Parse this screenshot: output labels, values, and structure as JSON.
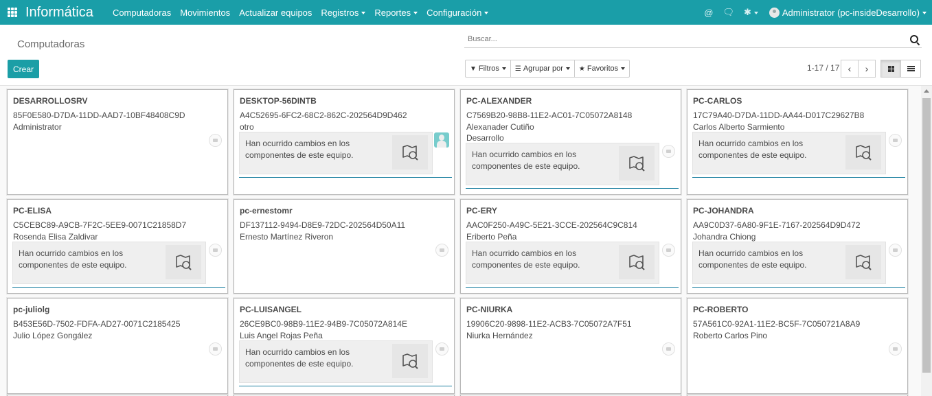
{
  "navbar": {
    "brand": "Informática",
    "menu": [
      {
        "label": "Computadoras",
        "has_caret": false
      },
      {
        "label": "Movimientos",
        "has_caret": false
      },
      {
        "label": "Actualizar equipos",
        "has_caret": false
      },
      {
        "label": "Registros",
        "has_caret": true
      },
      {
        "label": "Reportes",
        "has_caret": true
      },
      {
        "label": "Configuración",
        "has_caret": true
      }
    ],
    "user": "Administrator (pc-insideDesarrollo)",
    "color": "#1a9ea8"
  },
  "control_panel": {
    "breadcrumb": "Computadoras",
    "create_label": "Crear",
    "search_placeholder": "Buscar...",
    "filters_label": "Filtros",
    "group_by_label": "Agrupar por",
    "favorites_label": "Favoritos",
    "pager": "1-17 / 17"
  },
  "notice_text": "Han ocurrido cambios en los componentes de este equipo.",
  "cards": [
    {
      "name": "DESARROLLOSRV",
      "uuid": "85F0E580-D7DA-11DD-AAD7-10BF48408C9D",
      "line3": "Administrator",
      "line4": "",
      "has_notice": false,
      "has_photo": false
    },
    {
      "name": "DESKTOP-56DINTB",
      "uuid": "A4C52695-6FC2-68C2-862C-202564D9D462",
      "line3": "otro",
      "line4": "",
      "has_notice": true,
      "has_photo": true
    },
    {
      "name": "PC-ALEXANDER",
      "uuid": "C7569B20-98B8-11E2-AC01-7C05072A8148",
      "line3": "Alexanader Cutiño",
      "line4": "Desarrollo",
      "has_notice": true,
      "has_photo": false
    },
    {
      "name": "PC-CARLOS",
      "uuid": "17C79A40-D7DA-11DD-AA44-D017C29627B8",
      "line3": "Carlos Alberto Sarmiento",
      "line4": "",
      "has_notice": true,
      "has_photo": false
    },
    {
      "name": "PC-ELISA",
      "uuid": "C5CEBC89-A9CB-7F2C-5EE9-0071C21858D7",
      "line3": "Rosenda Elisa Zaldivar",
      "line4": "",
      "has_notice": true,
      "has_photo": false
    },
    {
      "name": "pc-ernestomr",
      "uuid": "DF137112-9494-D8E9-72DC-202564D50A11",
      "line3": "Ernesto Martínez Riveron",
      "line4": "",
      "has_notice": false,
      "has_photo": false
    },
    {
      "name": "PC-ERY",
      "uuid": "AAC0F250-A49C-5E21-3CCE-202564C9C814",
      "line3": "Eriberto Peña",
      "line4": "",
      "has_notice": true,
      "has_photo": false
    },
    {
      "name": "PC-JOHANDRA",
      "uuid": "AA9C0D37-6A80-9F1E-7167-202564D9D472",
      "line3": "Johandra Chiong",
      "line4": "",
      "has_notice": true,
      "has_photo": false
    },
    {
      "name": "pc-juliolg",
      "uuid": "B453E56D-7502-FDFA-AD27-0071C2185425",
      "line3": "Julio López Gongález",
      "line4": "",
      "has_notice": false,
      "has_photo": false
    },
    {
      "name": "PC-LUISANGEL",
      "uuid": "26CE9BC0-98B9-11E2-94B9-7C05072A814E",
      "line3": "Luis Angel Rojas Peña",
      "line4": "",
      "has_notice": true,
      "has_photo": false
    },
    {
      "name": "PC-NIURKA",
      "uuid": "19906C20-9898-11E2-ACB3-7C05072A7F51",
      "line3": "Niurka Hernández",
      "line4": "",
      "has_notice": false,
      "has_photo": false
    },
    {
      "name": "PC-ROBERTO",
      "uuid": "57A561C0-92A1-11E2-BC5F-7C050721A8A9",
      "line3": "Roberto Carlos Pino",
      "line4": "",
      "has_notice": false,
      "has_photo": false
    }
  ]
}
